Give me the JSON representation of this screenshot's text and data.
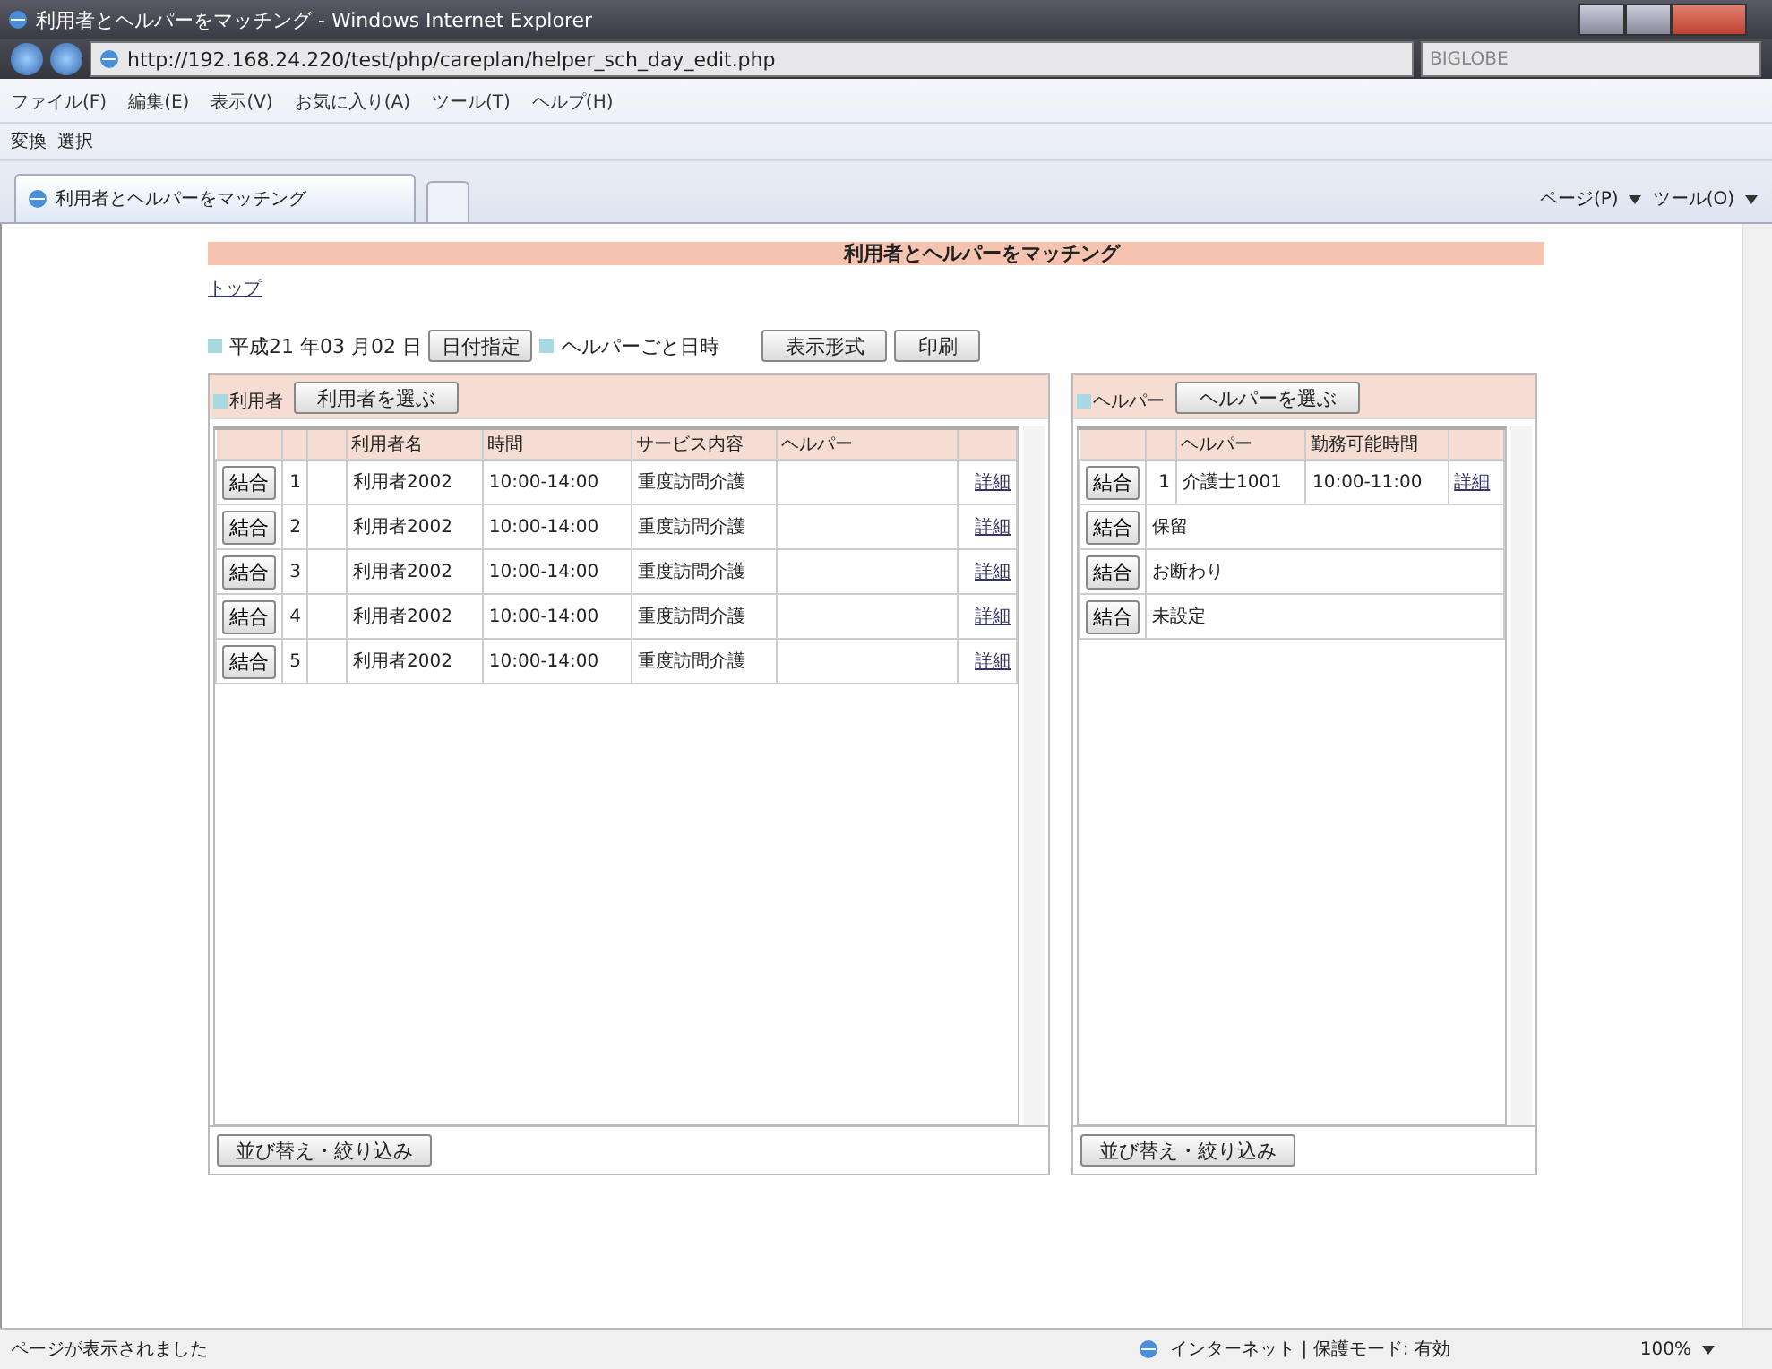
{
  "window": {
    "title": "利用者とヘルパーをマッチング - Windows Internet Explorer"
  },
  "address_bar": {
    "url": "http://192.168.24.220/test/php/careplan/helper_sch_day_edit.php"
  },
  "search": {
    "value": "BIGLOBE"
  },
  "menu": [
    "ファイル(F)",
    "編集(E)",
    "表示(V)",
    "お気に入り(A)",
    "ツール(T)",
    "ヘルプ(H)"
  ],
  "toolbar": [
    "変換",
    "選択"
  ],
  "tab": {
    "title": "利用者とヘルパーをマッチング"
  },
  "command_bar": [
    "ページ(P)",
    "ツール(O)"
  ],
  "page": {
    "title": "利用者とヘルパーをマッチング",
    "top_link": "トップ",
    "date": "平成21 年03 月02 日",
    "date_button": "日付指定",
    "mode_label": "ヘルパーごと日時",
    "buttons": [
      "表示形式",
      "印刷"
    ],
    "users": {
      "label": "利用者",
      "select_button": "利用者を選ぶ",
      "columns": {
        "name": "利用者名",
        "time": "時間",
        "service": "サービス内容",
        "helper": "ヘルパー"
      },
      "rows": [
        {
          "button": "結合",
          "no": "1",
          "name": "利用者2002",
          "time": "10:00-14:00",
          "service": "重度訪問介護",
          "link": "詳細"
        },
        {
          "button": "結合",
          "no": "2",
          "name": "利用者2002",
          "time": "10:00-14:00",
          "service": "重度訪問介護",
          "link": "詳細"
        },
        {
          "button": "結合",
          "no": "3",
          "name": "利用者2002",
          "time": "10:00-14:00",
          "service": "重度訪問介護",
          "link": "詳細"
        },
        {
          "button": "結合",
          "no": "4",
          "name": "利用者2002",
          "time": "10:00-14:00",
          "service": "重度訪問介護",
          "link": "詳細"
        },
        {
          "button": "結合",
          "no": "5",
          "name": "利用者2002",
          "time": "10:00-14:00",
          "service": "重度訪問介護",
          "link": "詳細"
        }
      ],
      "sort_button": "並び替え・絞り込み"
    },
    "helpers": {
      "label": "ヘルパー",
      "select_button": "ヘルパーを選ぶ",
      "columns": {
        "name": "ヘルパー",
        "time": "勤務可能時間"
      },
      "rows": [
        {
          "kind": "helper",
          "button": "結合",
          "no": "1",
          "name": "介護士1001",
          "time": "10:00-11:00",
          "link": "詳細"
        },
        {
          "kind": "status",
          "button": "結合",
          "text": "保留"
        },
        {
          "kind": "status",
          "button": "結合",
          "text": "お断わり"
        },
        {
          "kind": "status",
          "button": "結合",
          "text": "未設定"
        }
      ],
      "sort_button": "並び替え・絞り込み"
    }
  },
  "status_bar": {
    "text": "ページが表示されました",
    "zone": "インターネット | 保護モード: 有効",
    "zoom": "100%"
  }
}
